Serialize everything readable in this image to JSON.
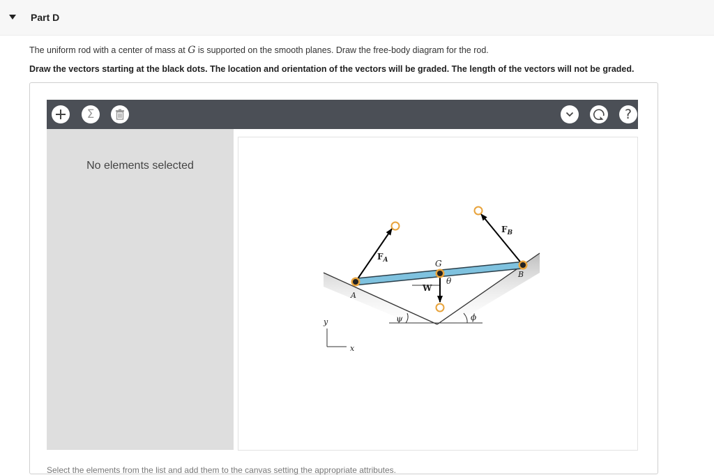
{
  "part": {
    "title": "Part D"
  },
  "question": {
    "line1_before": "The uniform rod with a center of mass at ",
    "line1_symbol": "G",
    "line1_after": " is supported on the smooth planes. Draw the free-body diagram for the rod.",
    "line2": "Draw the vectors starting at the black dots. The location and orientation of the vectors will be graded. The length of the vectors will not be graded."
  },
  "toolbar": {
    "left_icons": [
      "plus-icon",
      "sigma-icon",
      "trash-icon"
    ],
    "right_icons": [
      "chevron-down-icon",
      "reset-icon",
      "help-icon"
    ],
    "sigma_glyph": "Σ",
    "help_glyph": "?"
  },
  "sidebar": {
    "empty_message": "No elements selected"
  },
  "diagram": {
    "labels": {
      "fa_main": "F",
      "fa_sub": "A",
      "fb_main": "F",
      "fb_sub": "B",
      "g": "G",
      "w": "W",
      "theta": "θ",
      "a": "A",
      "b": "B",
      "psi": "ψ",
      "phi": "ϕ",
      "y": "y",
      "x": "x"
    },
    "colors": {
      "rod": "#7fc2df",
      "handle": "#e8a33b",
      "vector": "#000000"
    }
  },
  "footer": {
    "instruction": "Select the elements from the list and add them to the canvas setting the appropriate attributes."
  }
}
